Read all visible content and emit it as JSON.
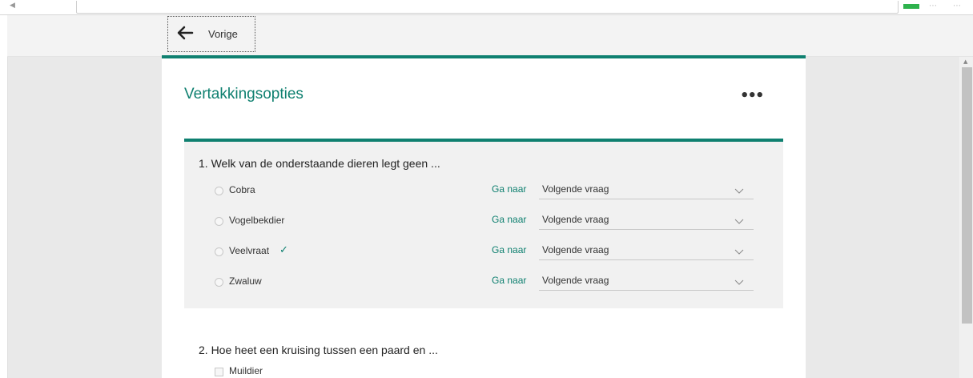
{
  "toolbar": {
    "back_label": "Vorige"
  },
  "form": {
    "title": "Vertakkingsopties",
    "more_label": "•••",
    "questions": [
      {
        "title": "1. Welk van de onderstaande dieren legt geen ...",
        "goto_label": "Ga naar",
        "options": [
          {
            "label": "Cobra",
            "correct": false,
            "target": "Volgende vraag"
          },
          {
            "label": "Vogelbekdier",
            "correct": false,
            "target": "Volgende vraag"
          },
          {
            "label": "Veelvraat",
            "correct": true,
            "target": "Volgende vraag"
          },
          {
            "label": "Zwaluw",
            "correct": false,
            "target": "Volgende vraag"
          }
        ]
      },
      {
        "title": "2. Hoe heet een kruising tussen een paard en ...",
        "options": [
          {
            "label": "Muildier"
          }
        ]
      }
    ]
  },
  "colors": {
    "accent": "#0f8070",
    "background": "#e9e9e9"
  },
  "icons": {
    "back": "arrow-left-icon",
    "correct": "checkmark-icon",
    "dropdown": "chevron-down-icon"
  }
}
